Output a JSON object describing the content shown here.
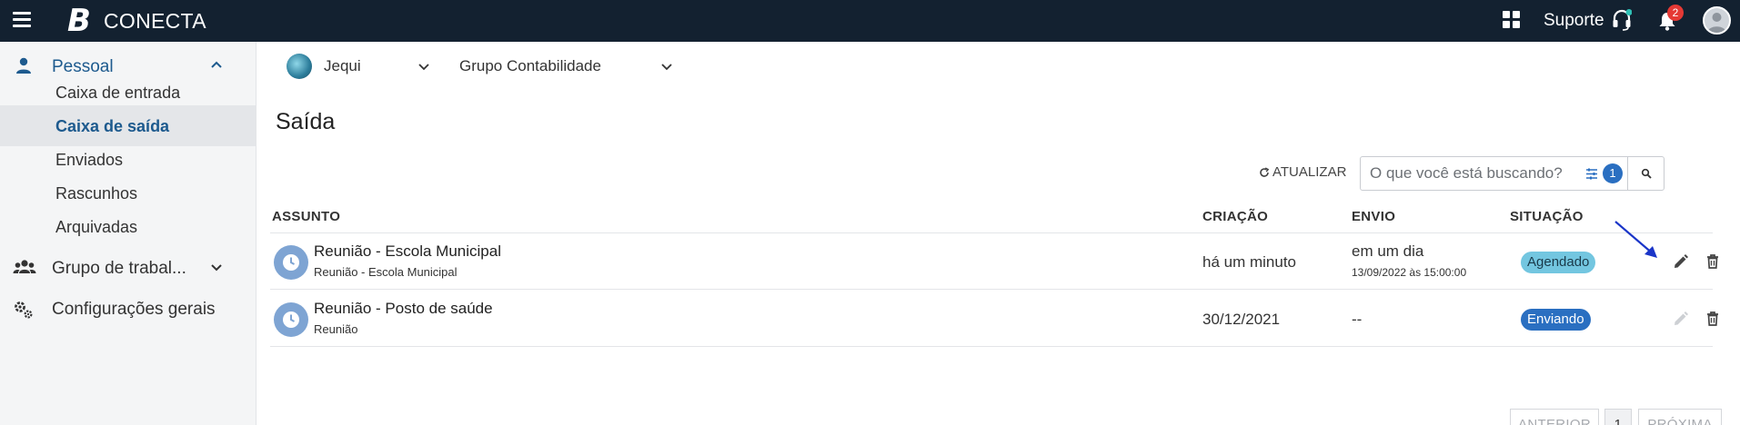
{
  "topbar": {
    "logo_letter": "B",
    "brand": "CONECTA",
    "support_label": "Suporte",
    "notifications_count": "2"
  },
  "sidebar": {
    "pessoal": {
      "label": "Pessoal",
      "items": [
        {
          "label": "Caixa de entrada"
        },
        {
          "label": "Caixa de saída",
          "active": true
        },
        {
          "label": "Enviados"
        },
        {
          "label": "Rascunhos"
        },
        {
          "label": "Arquivadas"
        }
      ]
    },
    "grupo": {
      "label": "Grupo de trabal..."
    },
    "config": {
      "label": "Configurações gerais"
    }
  },
  "main": {
    "org_select": "Jequi",
    "group_select": "Grupo Contabilidade",
    "title": "Saída",
    "refresh_label": "ATUALIZAR",
    "search_placeholder": "O que você está buscando?",
    "filter_count": "1",
    "columns": {
      "subject": "ASSUNTO",
      "created": "CRIAÇÃO",
      "sent": "ENVIO",
      "status": "SITUAÇÃO"
    },
    "rows": [
      {
        "subject": "Reunião - Escola Municipal",
        "subtitle": "Reunião - Escola Municipal",
        "created": "há um minuto",
        "sent": "em um dia",
        "sent_detail": "13/09/2022 às 15:00:00",
        "status": "Agendado",
        "status_color": "#73c6e0"
      },
      {
        "subject": "Reunião - Posto de saúde",
        "subtitle": "Reunião",
        "created": "30/12/2021",
        "sent": "--",
        "status": "Enviando",
        "status_color": "#2a6fc1"
      }
    ],
    "pagination": {
      "prev": "ANTERIOR",
      "page": "1",
      "next": "PRÓXIMA"
    }
  },
  "colors": {
    "topbar": "#132130",
    "accent": "#1d5a8e",
    "badge": "#e53935",
    "annotation_arrow": "#1a35c8"
  },
  "icons": [
    "menu-icon",
    "apps-grid-icon",
    "headset-icon",
    "bell-icon",
    "avatar-icon",
    "person-icon",
    "group-icon",
    "settings-icon",
    "chevron-up-icon",
    "chevron-down-icon",
    "refresh-icon",
    "filter-icon",
    "search-icon",
    "clock-icon",
    "edit-icon",
    "delete-icon"
  ]
}
